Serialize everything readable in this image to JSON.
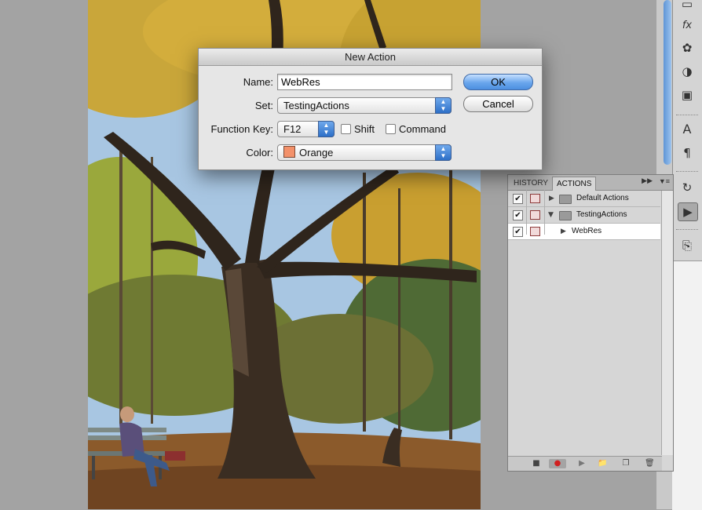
{
  "dialog": {
    "title": "New Action",
    "name_label": "Name:",
    "name_value": "WebRes",
    "set_label": "Set:",
    "set_value": "TestingActions",
    "function_key_label": "Function Key:",
    "function_key_value": "F12",
    "shift_label": "Shift",
    "command_label": "Command",
    "color_label": "Color:",
    "color_value": "Orange",
    "color_swatch": "#f3916a",
    "ok_label": "OK",
    "cancel_label": "Cancel"
  },
  "actions_panel": {
    "tabs": [
      "HISTORY",
      "ACTIONS"
    ],
    "active_tab": "ACTIONS",
    "rows": [
      {
        "label": "Default Actions",
        "kind": "set",
        "checked": true,
        "expanded": false
      },
      {
        "label": "TestingActions",
        "kind": "set",
        "checked": true,
        "expanded": true
      },
      {
        "label": "WebRes",
        "kind": "action",
        "checked": true,
        "expanded": false,
        "selected": true
      }
    ],
    "bottom_icons": [
      "stop-icon",
      "record-icon",
      "play-icon",
      "new-set-icon",
      "new-action-icon",
      "delete-icon"
    ]
  },
  "toolbar_icons": [
    "layers-icon",
    "fx-icon",
    "adjustments-icon",
    "masks-icon",
    "channels-icon",
    "character-icon",
    "paragraph-icon",
    "history-icon",
    "actions-icon",
    "clone-source-icon"
  ]
}
